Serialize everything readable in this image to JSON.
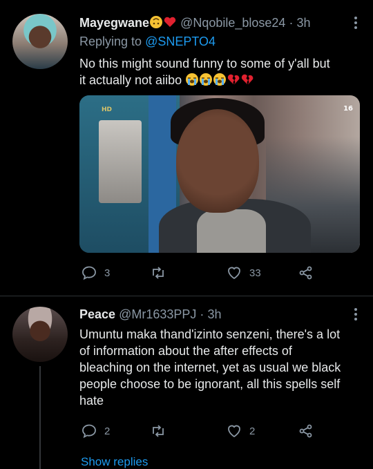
{
  "tweets": [
    {
      "name": "Mayegwane",
      "name_emojis": [
        "upside-down-face",
        "red-heart"
      ],
      "handle": "@Nqobile_blose24",
      "separator": "·",
      "time": "3h",
      "replying_label": "Replying to",
      "replying_handle": "@SNEPTO4",
      "text_line1": "No this might sound funny to some of y'all but",
      "text_line2": "it actually not aiibo",
      "trailing_emojis": [
        "loudly-crying-face",
        "loudly-crying-face",
        "loudly-crying-face",
        "broken-heart",
        "broken-heart"
      ],
      "media": {
        "channel_logo": "HD",
        "rating": "16"
      },
      "replies": "3",
      "retweets": "",
      "likes": "33"
    },
    {
      "name": "Peace",
      "handle": "@Mr1633PPJ",
      "separator": "·",
      "time": "3h",
      "text_line1": "Umuntu maka thand'izinto senzeni, there's a lot",
      "text_line2": "of information about the after effects of",
      "text_line3": "bleaching on the internet, yet as usual we black",
      "text_line4": "people choose to be ignorant, all this spells self",
      "text_line5": "hate",
      "replies": "2",
      "retweets": "",
      "likes": "2"
    }
  ],
  "show_replies_label": "Show replies",
  "colors": {
    "background": "#000000",
    "text": "#e7e9ea",
    "muted": "#8b98a5",
    "link": "#1d9bf0"
  }
}
